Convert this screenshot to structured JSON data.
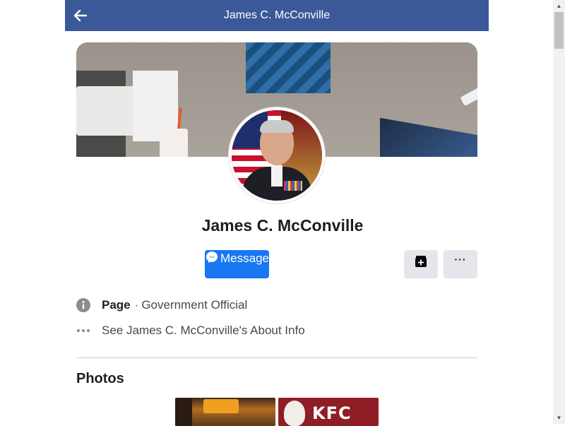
{
  "header": {
    "title": "James C. McConville",
    "back_icon": "arrow-left-icon"
  },
  "profile": {
    "name": "James C. McConville",
    "cover_photo": "cover-photo",
    "avatar": "profile-picture"
  },
  "actions": {
    "message_label": "Message",
    "message_icon": "messenger-icon",
    "save_icon": "bookmark-add-icon",
    "more_label": "···"
  },
  "info": {
    "category_bold": "Page",
    "category_sep": "·",
    "category_text": "Government Official",
    "about_link": "See James C. McConville's About Info",
    "info_icon": "info-icon",
    "more_icon": "ellipsis-icon"
  },
  "photos": {
    "title": "Photos",
    "items": [
      {
        "name": "photo-bar-interior"
      },
      {
        "name": "photo-kfc",
        "caption": "KFC"
      }
    ]
  },
  "colors": {
    "header_bg": "#3b5998",
    "message_bg": "#1877f2",
    "secondary_btn_bg": "#e4e6eb"
  }
}
